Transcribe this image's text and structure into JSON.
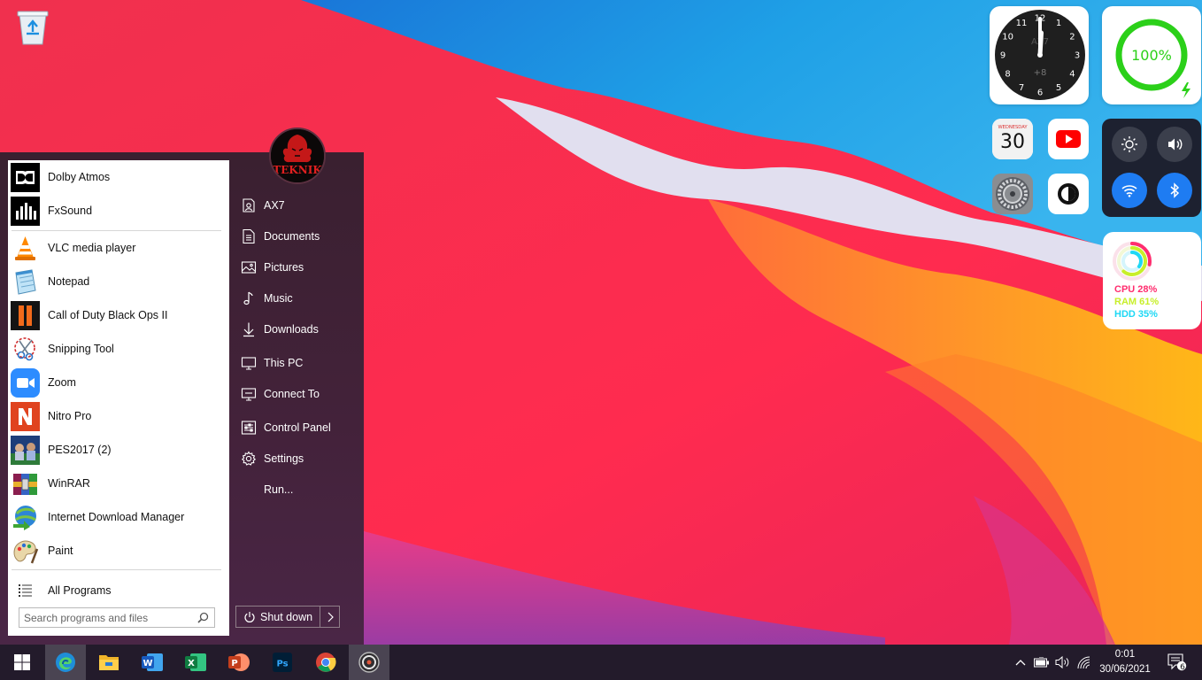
{
  "desktop": {
    "recycle_icon": "recycle-bin-icon"
  },
  "start_menu": {
    "programs": [
      {
        "label": "Dolby Atmos",
        "icon": "dolby-atmos-icon"
      },
      {
        "label": "FxSound",
        "icon": "fxsound-icon"
      },
      {
        "label": "VLC media player",
        "icon": "vlc-icon"
      },
      {
        "label": "Notepad",
        "icon": "notepad-icon"
      },
      {
        "label": "Call of Duty Black Ops II",
        "icon": "call-of-duty-icon"
      },
      {
        "label": "Snipping Tool",
        "icon": "snipping-tool-icon"
      },
      {
        "label": "Zoom",
        "icon": "zoom-icon"
      },
      {
        "label": "Nitro Pro",
        "icon": "nitro-pro-icon"
      },
      {
        "label": "PES2017 (2)",
        "icon": "pes2017-icon"
      },
      {
        "label": "WinRAR",
        "icon": "winrar-icon"
      },
      {
        "label": "Internet Download Manager",
        "icon": "idm-icon"
      },
      {
        "label": "Paint",
        "icon": "paint-icon"
      }
    ],
    "all_programs": "All Programs",
    "search_placeholder": "Search programs and files",
    "avatar_text": "TEKNIK",
    "places": [
      {
        "label": "AX7",
        "icon": "user-folder-icon"
      },
      {
        "label": "Documents",
        "icon": "documents-icon"
      },
      {
        "label": "Pictures",
        "icon": "pictures-icon"
      },
      {
        "label": "Music",
        "icon": "music-icon"
      },
      {
        "label": "Downloads",
        "icon": "downloads-icon"
      },
      {
        "label": "This PC",
        "icon": "this-pc-icon"
      },
      {
        "label": "Connect To",
        "icon": "connect-to-icon"
      },
      {
        "label": "Control Panel",
        "icon": "control-panel-icon"
      },
      {
        "label": "Settings",
        "icon": "settings-gear-icon"
      },
      {
        "label": "Run...",
        "icon": "run-icon"
      }
    ],
    "shutdown": "Shut down"
  },
  "widgets": {
    "clock": {
      "numbers": [
        "12",
        "1",
        "2",
        "3",
        "4",
        "5",
        "6",
        "7",
        "8",
        "9",
        "10",
        "11"
      ],
      "label": "AX7",
      "offset": "+8"
    },
    "battery": {
      "percent_text": "100%",
      "level": 1.0
    },
    "calendar": {
      "weekday": "WEDNESDAY",
      "day": "30"
    },
    "system_stats": {
      "cpu": "CPU 28%",
      "ram": "RAM 61%",
      "hdd": "HDD 35%",
      "cpu_level": 0.28,
      "ram_level": 0.61,
      "hdd_level": 0.35
    }
  },
  "taskbar": {
    "apps": [
      "start-icon",
      "edge-icon",
      "file-explorer-icon",
      "word-icon",
      "excel-icon",
      "powerpoint-icon",
      "photoshop-icon",
      "chrome-icon",
      "obs-icon"
    ],
    "time": "0:01",
    "date": "30/06/2021",
    "notification_count": "6"
  },
  "colors": {
    "menu_bg": "#3a2030",
    "taskbar_bg": "#231b2b",
    "battery_green": "#2bd019",
    "cpu": "#ff2d6e",
    "ram": "#c8ef2a",
    "hdd": "#1ed8f5"
  }
}
